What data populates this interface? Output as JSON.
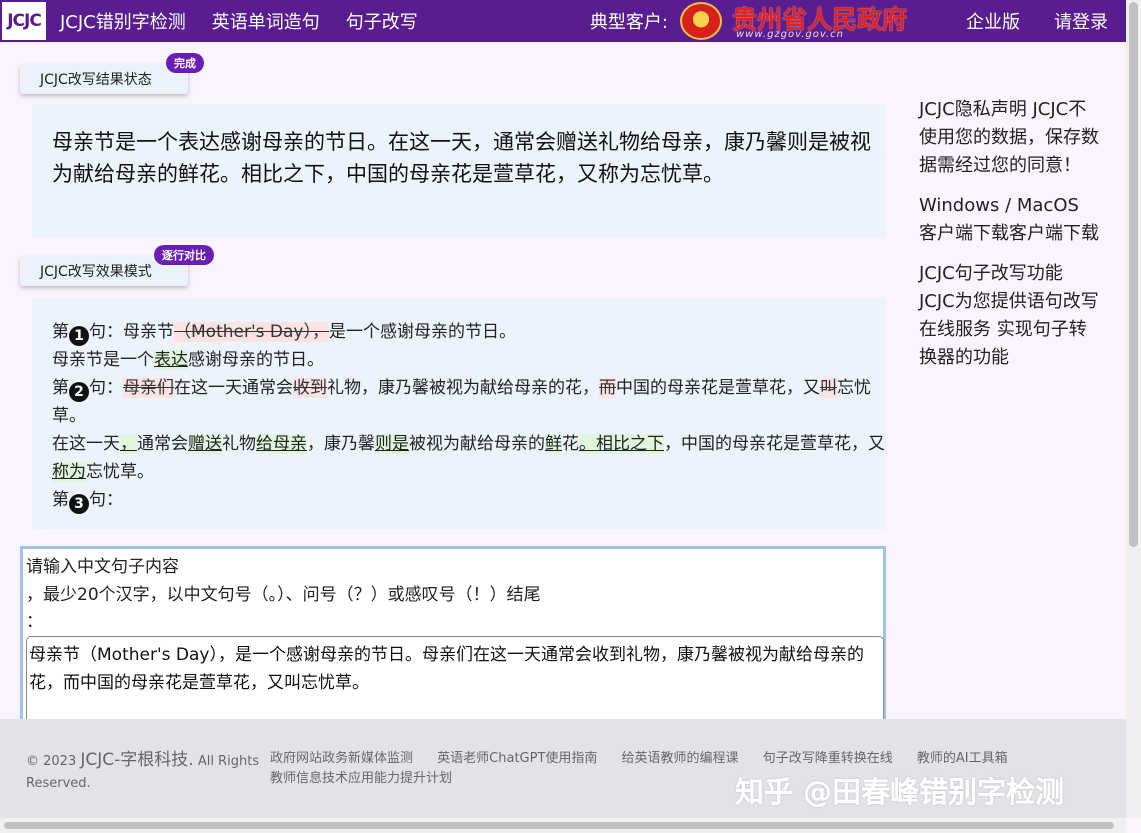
{
  "nav": {
    "logo": "JCJC",
    "links": [
      "JCJC错别字检测",
      "英语单词造句",
      "句子改写"
    ],
    "client_label": "典型客户:",
    "gov_name": "贵州省人民政府",
    "gov_url": "www.gzgov.gov.cn",
    "enterprise": "企业版",
    "login": "请登录"
  },
  "status": {
    "label": "JCJC改写结果状态",
    "badge": "完成",
    "result_text": "母亲节是一个表达感谢母亲的节日。在这一天，通常会赠送礼物给母亲，康乃馨则是被视为献给母亲的鲜花。相比之下，中国的母亲花是萱草花，又称为忘忧草。"
  },
  "mode": {
    "label": "JCJC改写效果模式",
    "badge": "逐行对比"
  },
  "compare": {
    "prefix": "第",
    "suffix": "句：",
    "n1": "1",
    "n2": "2",
    "n3": "3",
    "s1_a": "母亲节",
    "s1_del": "（Mother's Day），",
    "s1_b": "是一个感谢母亲的节日。",
    "r1_a": "母亲节是一个",
    "r1_ins": "表达",
    "r1_b": "感谢母亲的节日。",
    "s2_del1": "母亲们",
    "s2_a": "在这一天通常会",
    "s2_del2": "收到",
    "s2_b": "礼物，康乃馨被视为献给母亲的花，",
    "s2_del3": "而",
    "s2_c": "中国的母亲花是萱草花，又",
    "s2_del4": "叫",
    "s2_d": "忘忧草。",
    "r2_a": "在这一天",
    "r2_ins1": "，",
    "r2_b": "通常会",
    "r2_ins2": "赠送",
    "r2_c": "礼物",
    "r2_ins3": "给母亲",
    "r2_d": "，康乃馨",
    "r2_ins4": "则是",
    "r2_e": "被视为献给母亲的",
    "r2_ins5": "鲜",
    "r2_f": "花",
    "r2_ins6": "。相比之下",
    "r2_g": "，中国的母亲花是萱草花，又",
    "r2_ins7": "称为",
    "r2_h": "忘忧草。"
  },
  "sidebar": {
    "privacy": "JCJC隐私声明 JCJC不使用您的数据，保存数据需经过您的同意！",
    "download": "Windows / MacOS 客户端下载客户端下载",
    "feature": "JCJC句子改写功能 JCJC为您提供语句改写在线服务 实现句子转换器的功能"
  },
  "input": {
    "line1": "请输入中文句子内容",
    "line2": "，最少20个汉字，以中文句号（。）、问号（？）或感叹号（！）结尾",
    "line3": "：",
    "value": "母亲节（Mother's Day），是一个感谢母亲的节日。母亲们在这一天通常会收到礼物，康乃馨被视为献给母亲的花，而中国的母亲花是萱草花，又叫忘忧草。"
  },
  "footer": {
    "copyright_pre": "© 2023",
    "company": "JCJC-字根科技.",
    "rights": "All Rights Reserved.",
    "links": [
      "政府网站政务新媒体监测",
      "英语老师ChatGPT使用指南",
      "给英语教师的编程课",
      "句子改写降重转换在线",
      "教师的AI工具箱",
      "教师信息技术应用能力提升计划"
    ],
    "watermark": "知乎 @田春峰错别字检测"
  }
}
